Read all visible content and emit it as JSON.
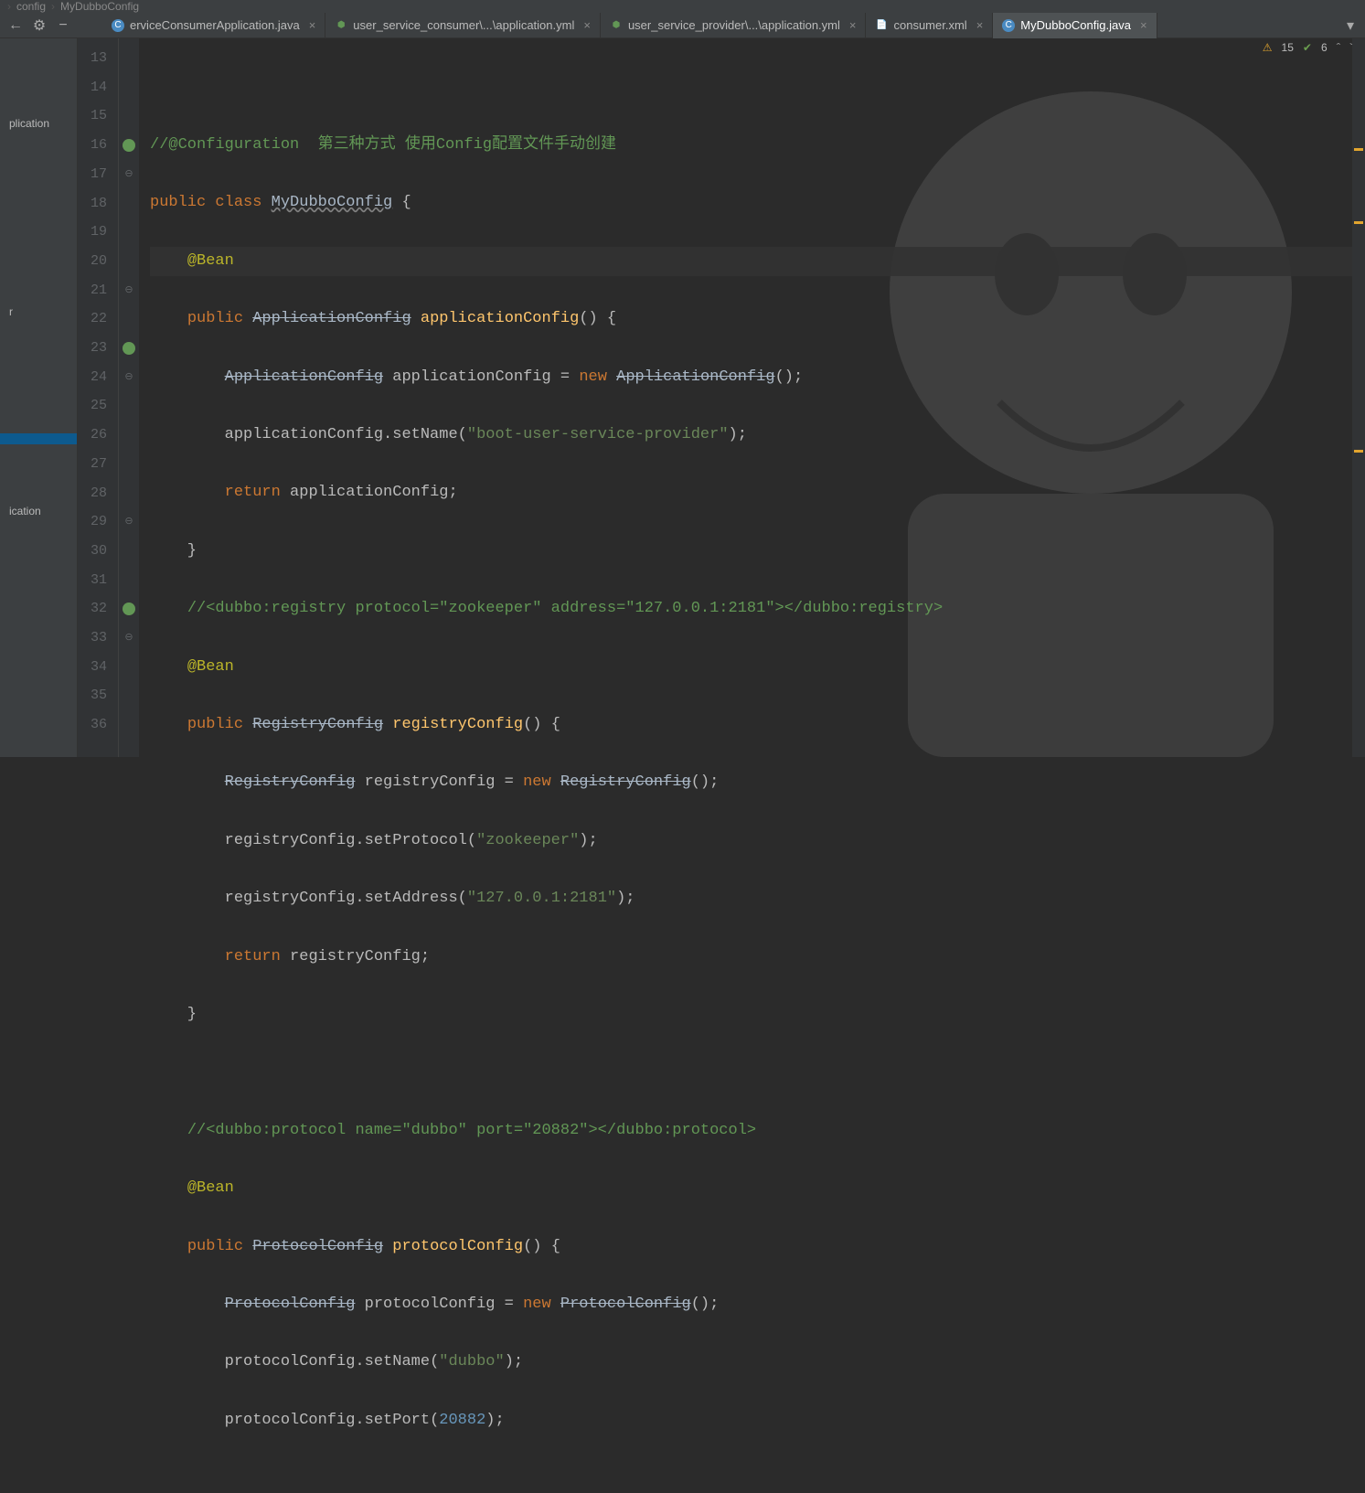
{
  "breadcrumb": {
    "part1": "config",
    "part2": "MyDubboConfig",
    "sep": "›"
  },
  "toolbar": {
    "backIcon": "←",
    "gearIcon": "⚙",
    "minusIcon": "−"
  },
  "tabs": [
    {
      "label": "erviceConsumerApplication.java",
      "icon": "C",
      "active": false
    },
    {
      "label": "user_service_consumer\\...\\application.yml",
      "icon": "⬢",
      "active": false
    },
    {
      "label": "user_service_provider\\...\\application.yml",
      "icon": "⬢",
      "active": false
    },
    {
      "label": "consumer.xml",
      "icon": "📄",
      "active": false
    },
    {
      "label": "MyDubboConfig.java",
      "icon": "C",
      "active": true
    }
  ],
  "sidebar": {
    "items": [
      {
        "label": "plication",
        "active": false
      },
      {
        "label": "r",
        "active": false
      },
      {
        "label": "",
        "active": true
      },
      {
        "label": "ication",
        "active": false
      }
    ]
  },
  "inspections": {
    "warnIcon": "⚠",
    "warnCount": "15",
    "okIcon": "✔",
    "okCount": "6"
  },
  "gutter": {
    "start": 13,
    "end": 36,
    "icons": {
      "16": "bean",
      "17": "fold",
      "21": "fold",
      "23": "bean",
      "24": "fold",
      "29": "fold",
      "32": "bean",
      "33": "fold"
    }
  },
  "code_strings": {
    "config_comment": "//@Configuration  第三种方式 使用Config配置文件手动创建",
    "bean_anno": "@Bean",
    "public": "public",
    "class": "class",
    "return": "return",
    "new": "new",
    "MyDubboConfig": "MyDubboConfig",
    "ApplicationConfig": "ApplicationConfig",
    "applicationConfig_m": "applicationConfig",
    "setName": "setName",
    "boot_str": "\"boot-user-service-provider\"",
    "reg_comment": "//<dubbo:registry protocol=\"zookeeper\" address=\"127.0.0.1:2181\"></dubbo:registry>",
    "RegistryConfig": "RegistryConfig",
    "registryConfig_m": "registryConfig",
    "setProtocol": "setProtocol",
    "zookeeper_str": "\"zookeeper\"",
    "setAddress": "setAddress",
    "addr_str": "\"127.0.0.1:2181\"",
    "proto_comment": "//<dubbo:protocol name=\"dubbo\" port=\"20882\"></dubbo:protocol>",
    "ProtocolConfig": "ProtocolConfig",
    "protocolConfig_m": "protocolConfig",
    "dubbo_str": "\"dubbo\"",
    "setPort": "setPort",
    "port_num": "20882"
  }
}
